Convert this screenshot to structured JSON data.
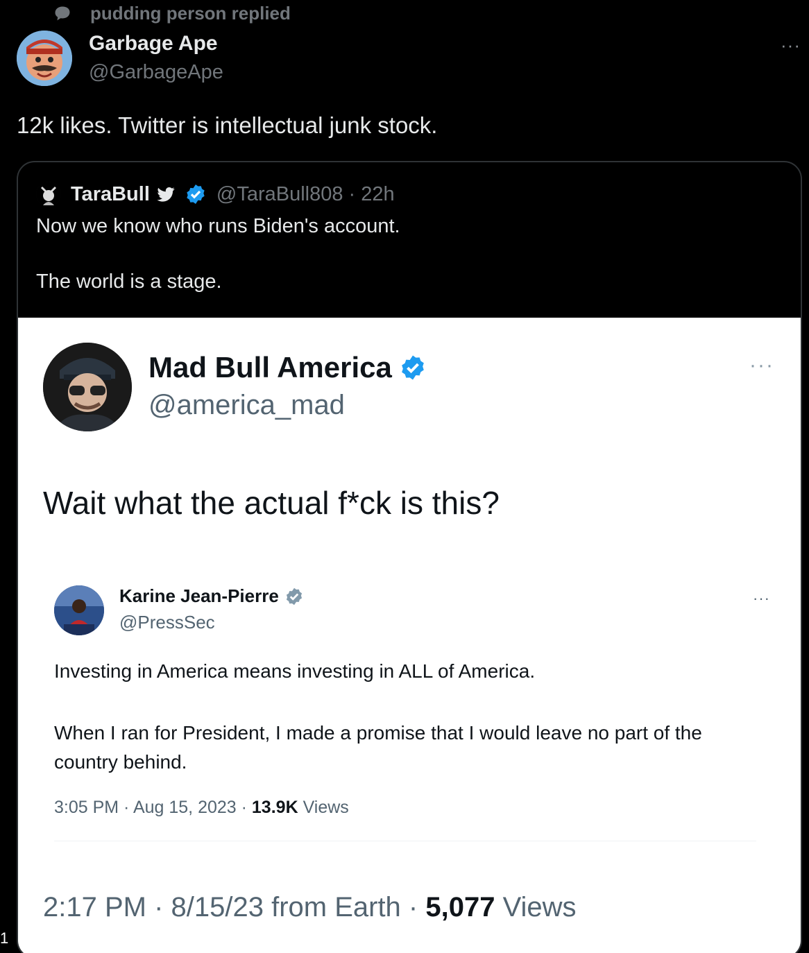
{
  "reply_context": {
    "text": "pudding person replied"
  },
  "author": {
    "name": "Garbage Ape",
    "handle": "@GarbageApe"
  },
  "tweet": {
    "text": "12k likes. Twitter is intellectual junk stock."
  },
  "more_label": "···",
  "quote": {
    "name": "TaraBull",
    "handle_time": "@TaraBull808 · 22h",
    "line1": "Now we know who runs Biden's account.",
    "line2": "The world is a stage."
  },
  "screenshot": {
    "name": "Mad Bull America",
    "handle": "@america_mad",
    "text": "Wait what the actual f*ck is this?",
    "meta_time": "2:17 PM · 8/15/23 from Earth · ",
    "meta_views_count": "5,077",
    "meta_views_label": " Views",
    "inner": {
      "name": "Karine Jean-Pierre",
      "handle": "@PressSec",
      "line1": "Investing in America means investing in ALL of America.",
      "line2": "When I ran for President, I made a promise that I would leave no part of the country behind.",
      "meta_time": "3:05 PM · Aug 15, 2023 · ",
      "meta_views_count": "13.9K",
      "meta_views_label": " Views"
    }
  },
  "edge_label": "1",
  "colors": {
    "verified_blue": "#1d9bf0",
    "muted": "#71767b",
    "border": "#2f3336"
  }
}
